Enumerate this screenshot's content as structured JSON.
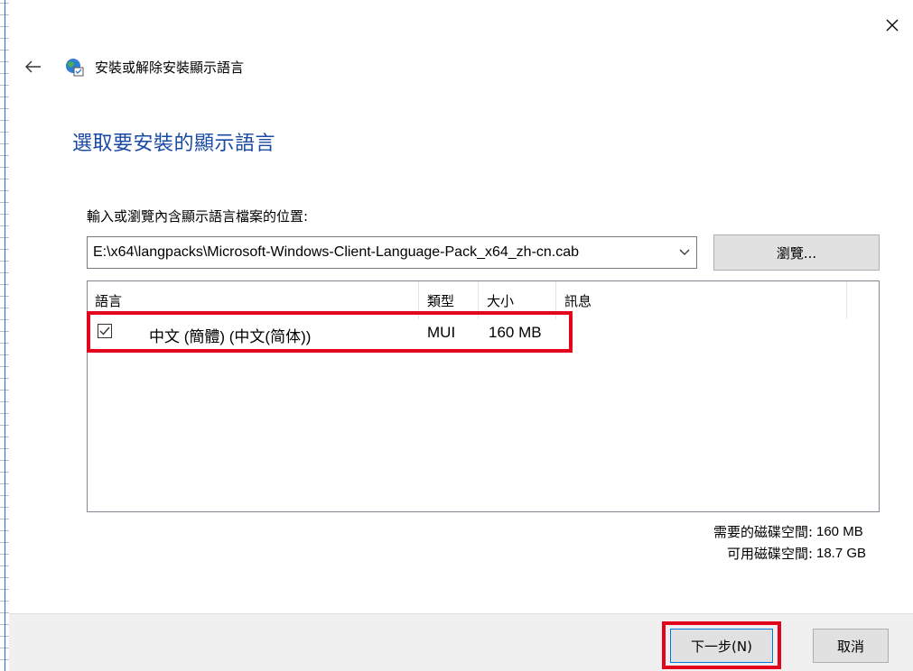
{
  "window": {
    "close_icon": "close-icon",
    "back_icon": "back-arrow-icon",
    "header_icon": "language-globe-icon",
    "header_title": "安裝或解除安裝顯示語言"
  },
  "page": {
    "heading": "選取要安裝的顯示語言",
    "location_label": "輸入或瀏覽內含顯示語言檔案的位置:",
    "path_value": "E:\\x64\\langpacks\\Microsoft-Windows-Client-Language-Pack_x64_zh-cn.cab",
    "browse_label": "瀏覽..."
  },
  "list": {
    "columns": [
      "語言",
      "類型",
      "大小",
      "訊息"
    ],
    "rows": [
      {
        "checked": true,
        "language": "中文 (簡體) (中文(简体))",
        "type": "MUI",
        "size": "160 MB",
        "message": ""
      }
    ]
  },
  "disk": {
    "required_label": "需要的磁碟空間:",
    "required_value": "160 MB",
    "available_label": "可用磁碟空間:",
    "available_value": "18.7 GB"
  },
  "footer": {
    "next_label": "下一步(N)",
    "cancel_label": "取消"
  },
  "colors": {
    "heading": "#1a49a3",
    "highlight": "#e3051c",
    "primary_border": "#0078d7"
  }
}
